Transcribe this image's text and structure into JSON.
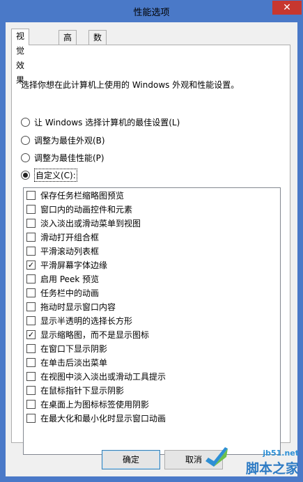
{
  "window": {
    "title": "性能选项",
    "close_glyph": "✕"
  },
  "tabs": [
    {
      "label": "视觉效果",
      "active": true
    },
    {
      "label": "高级",
      "active": false
    },
    {
      "label": "数据执行保护",
      "active": false
    }
  ],
  "description": "选择你想在此计算机上使用的 Windows 外观和性能设置。",
  "radios": [
    {
      "label": "让 Windows 选择计算机的最佳设置(L)",
      "checked": false
    },
    {
      "label": "调整为最佳外观(B)",
      "checked": false
    },
    {
      "label": "调整为最佳性能(P)",
      "checked": false
    },
    {
      "label": "自定义(C):",
      "checked": true
    }
  ],
  "options": [
    {
      "label": "保存任务栏缩略图预览",
      "checked": false
    },
    {
      "label": "窗口内的动画控件和元素",
      "checked": false
    },
    {
      "label": "淡入淡出或滑动菜单到视图",
      "checked": false
    },
    {
      "label": "滑动打开组合框",
      "checked": false
    },
    {
      "label": "平滑滚动列表框",
      "checked": false
    },
    {
      "label": "平滑屏幕字体边缘",
      "checked": true
    },
    {
      "label": "启用 Peek 预览",
      "checked": false
    },
    {
      "label": "任务栏中的动画",
      "checked": false
    },
    {
      "label": "拖动时显示窗口内容",
      "checked": false
    },
    {
      "label": "显示半透明的选择长方形",
      "checked": false
    },
    {
      "label": "显示缩略图，而不是显示图标",
      "checked": true
    },
    {
      "label": "在窗口下显示阴影",
      "checked": false
    },
    {
      "label": "在单击后淡出菜单",
      "checked": false
    },
    {
      "label": "在视图中淡入淡出或滑动工具提示",
      "checked": false
    },
    {
      "label": "在鼠标指针下显示阴影",
      "checked": false
    },
    {
      "label": "在桌面上为图标标签使用阴影",
      "checked": false
    },
    {
      "label": "在最大化和最小化时显示窗口动画",
      "checked": false
    }
  ],
  "buttons": {
    "ok": "确定",
    "cancel": "取消"
  },
  "watermark": {
    "url": "jb51.net",
    "text": "脚本之家"
  },
  "colors": {
    "frame": "#4a79c8",
    "close": "#c7372f",
    "watermark": "#2e7bc4"
  }
}
